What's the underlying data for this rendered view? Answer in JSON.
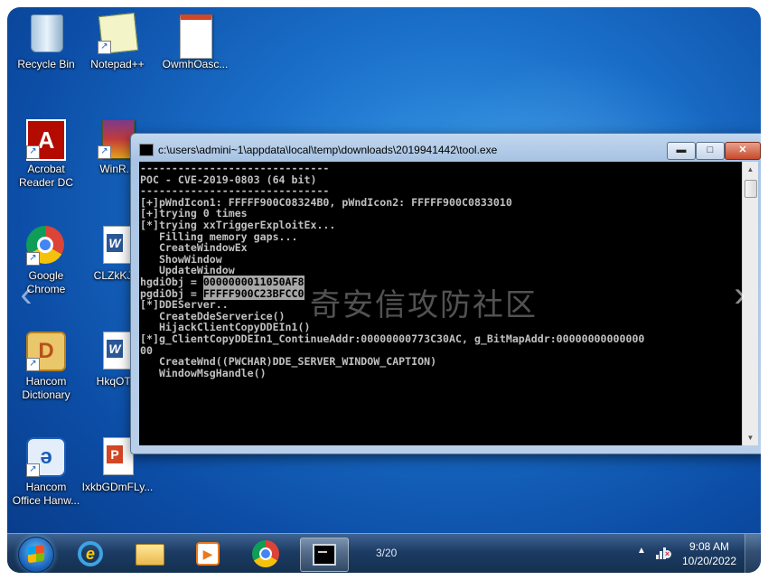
{
  "desktop": {
    "icons": [
      {
        "label": "Recycle Bin",
        "icon": "recycle-bin-icon"
      },
      {
        "label": "Notepad++",
        "icon": "notepad-plus-plus-icon"
      },
      {
        "label": "OwmhOasc...",
        "icon": "document-icon"
      },
      {
        "label": "Acrobat\nReader DC",
        "icon": "acrobat-reader-icon"
      },
      {
        "label": "WinR...",
        "icon": "winrar-icon"
      },
      {
        "label": "Google\nChrome",
        "icon": "chrome-icon"
      },
      {
        "label": "CLZkKJ...",
        "icon": "word-document-icon"
      },
      {
        "label": "Hancom\nDictionary",
        "icon": "hancom-dictionary-icon"
      },
      {
        "label": "HkqOT...",
        "icon": "word-document-icon"
      },
      {
        "label": "Hancom\nOffice Hanw...",
        "icon": "hancom-office-icon"
      },
      {
        "label": "IxkbGDmFLy...",
        "icon": "powerpoint-document-icon"
      }
    ],
    "watermark": "奇安信攻防社区"
  },
  "console_window": {
    "title": "c:\\users\\admini~1\\appdata\\local\\temp\\downloads\\2019941442\\tool.exe",
    "minimize_glyph": "▬",
    "maximize_glyph": "□",
    "close_glyph": "✕",
    "lines": [
      "------------------------------",
      "POC - CVE-2019-0803 (64 bit)",
      "------------------------------",
      "[+]pWndIcon1: FFFFF900C08324B0, pWndIcon2: FFFFF900C0833010",
      "[+]trying 0 times",
      "[*]trying xxTriggerExploitEx...",
      "   Filling memory gaps...",
      "   CreateWindowEx",
      "   ShowWindow",
      "   UpdateWindow",
      "hgdiObj = 0000000011050AF8",
      "pgdiObj = FFFFF900C23BFCC0",
      "[*]DDEServer..",
      "   CreateDdeServerice()",
      "   HijackClientCopyDDEIn1()",
      "[*]g_ClientCopyDDEIn1_ContinueAddr:00000000773C30AC, g_BitMapAddr:00000000000000",
      "00",
      "   CreateWnd((PWCHAR)DDE_SERVER_WINDOW_CAPTION)",
      "   WindowMsgHandle()"
    ]
  },
  "taskbar": {
    "items": [
      "start-button",
      "internet-explorer",
      "windows-explorer",
      "media-player",
      "google-chrome",
      "console"
    ],
    "page_counter": "3/20",
    "tray_arrow": "▲",
    "time": "9:08 AM",
    "date": "10/20/2022"
  }
}
